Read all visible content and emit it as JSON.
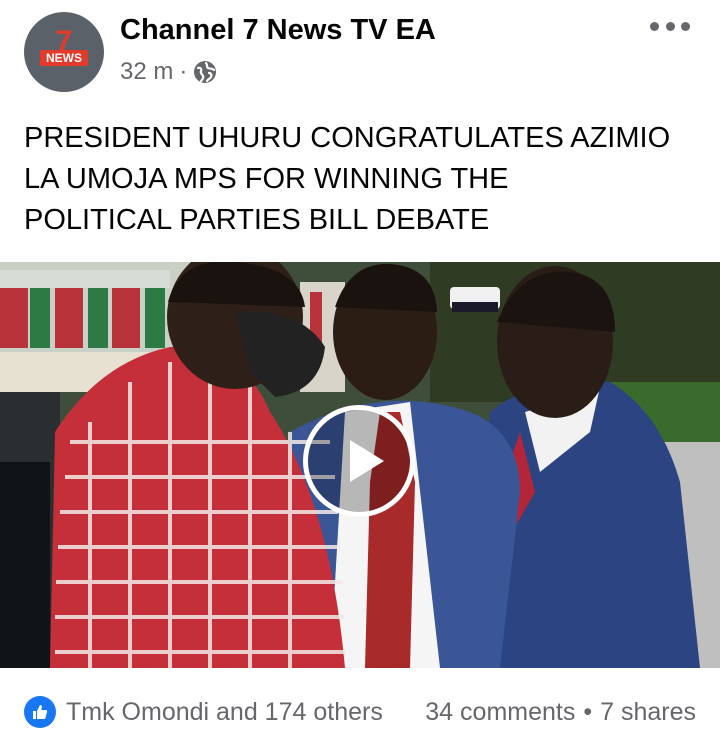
{
  "post": {
    "page_name": "Channel 7 News TV EA",
    "time": "32 m",
    "separator": "·",
    "audience_icon": "globe-icon",
    "more_icon": "more-options-icon",
    "avatar": {
      "logo_number": "7",
      "logo_text": "NEWS"
    },
    "text_line1": "PRESIDENT UHURU CONGRATULATES AZIMIO",
    "text_line2": "LA UMOJA MPS FOR WINNING THE",
    "text_line3": "POLITICAL PARTIES BILL DEBATE",
    "media": {
      "type": "video",
      "play_icon": "play-icon"
    }
  },
  "footer": {
    "reaction_icon": "like-icon",
    "reactions_label": "Tmk Omondi and 174 others",
    "comments_label": "34 comments",
    "dot": "•",
    "shares_label": "7 shares"
  },
  "colors": {
    "accent": "#1877f2",
    "secondary_text": "#65676b",
    "logo_red": "#e23b2c"
  }
}
